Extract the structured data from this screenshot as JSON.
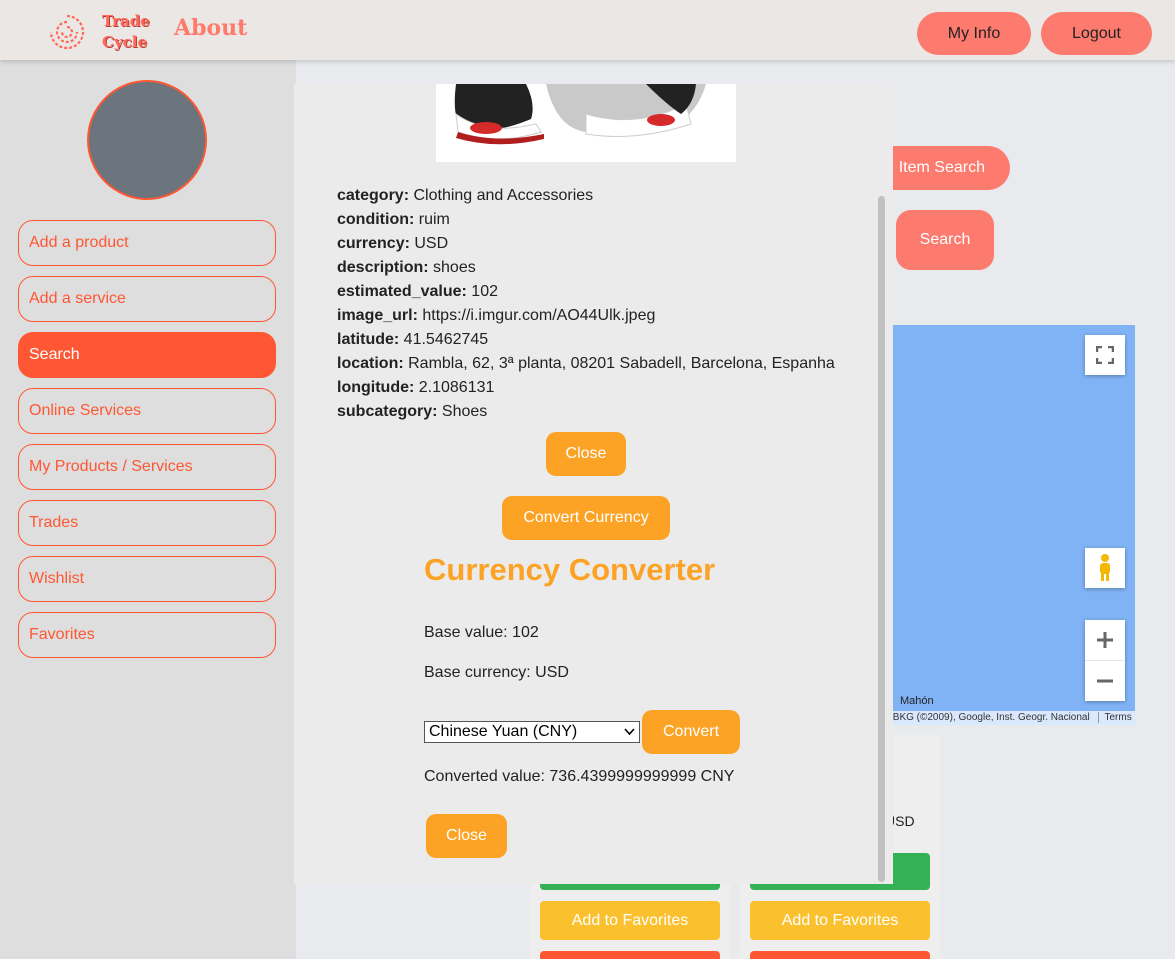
{
  "header": {
    "logo_line1": "Trade",
    "logo_line2": "Cycle",
    "about": "About",
    "my_info": "My Info",
    "logout": "Logout"
  },
  "sidebar": {
    "items": [
      {
        "label": "Add a product"
      },
      {
        "label": "Add a service"
      },
      {
        "label": "Search",
        "active": true
      },
      {
        "label": "Online Services"
      },
      {
        "label": "My Products / Services"
      },
      {
        "label": "Trades"
      },
      {
        "label": "Wishlist"
      },
      {
        "label": "Favorites"
      }
    ]
  },
  "background": {
    "item_search_partial": "Item Search",
    "search_button": "Search",
    "usd_partial": "USD",
    "add_to_favorites": "Add to Favorites",
    "map": {
      "place_label": "Mahón",
      "attribution": "/BKG (©2009), Google, Inst. Geogr. Nacional",
      "terms": "Terms"
    }
  },
  "modal": {
    "details": [
      {
        "key": "category:",
        "value": "Clothing and Accessories"
      },
      {
        "key": "condition:",
        "value": "ruim"
      },
      {
        "key": "currency:",
        "value": "USD"
      },
      {
        "key": "description:",
        "value": "shoes"
      },
      {
        "key": "estimated_value:",
        "value": "102"
      },
      {
        "key": "image_url:",
        "value": "https://i.imgur.com/AO44Ulk.jpeg"
      },
      {
        "key": "latitude:",
        "value": "41.5462745"
      },
      {
        "key": "location:",
        "value": "Rambla, 62, 3ª planta, 08201 Sabadell, Barcelona, Espanha"
      },
      {
        "key": "longitude:",
        "value": "2.1086131"
      },
      {
        "key": "subcategory:",
        "value": "Shoes"
      }
    ],
    "close_label": "Close",
    "convert_currency_label": "Convert Currency",
    "converter": {
      "title": "Currency Converter",
      "base_value": "Base value: 102",
      "base_currency": "Base currency: USD",
      "selected_currency": "Chinese Yuan (CNY)",
      "convert_label": "Convert",
      "converted_value": "Converted value: 736.4399999999999 CNY",
      "close_label": "Close"
    }
  },
  "colors": {
    "accent": "#ff5733",
    "salmon": "#fd7a6e",
    "orange": "#fca326",
    "green": "#34b155",
    "yellow": "#fbc02d",
    "map_water": "#80b3f5"
  }
}
